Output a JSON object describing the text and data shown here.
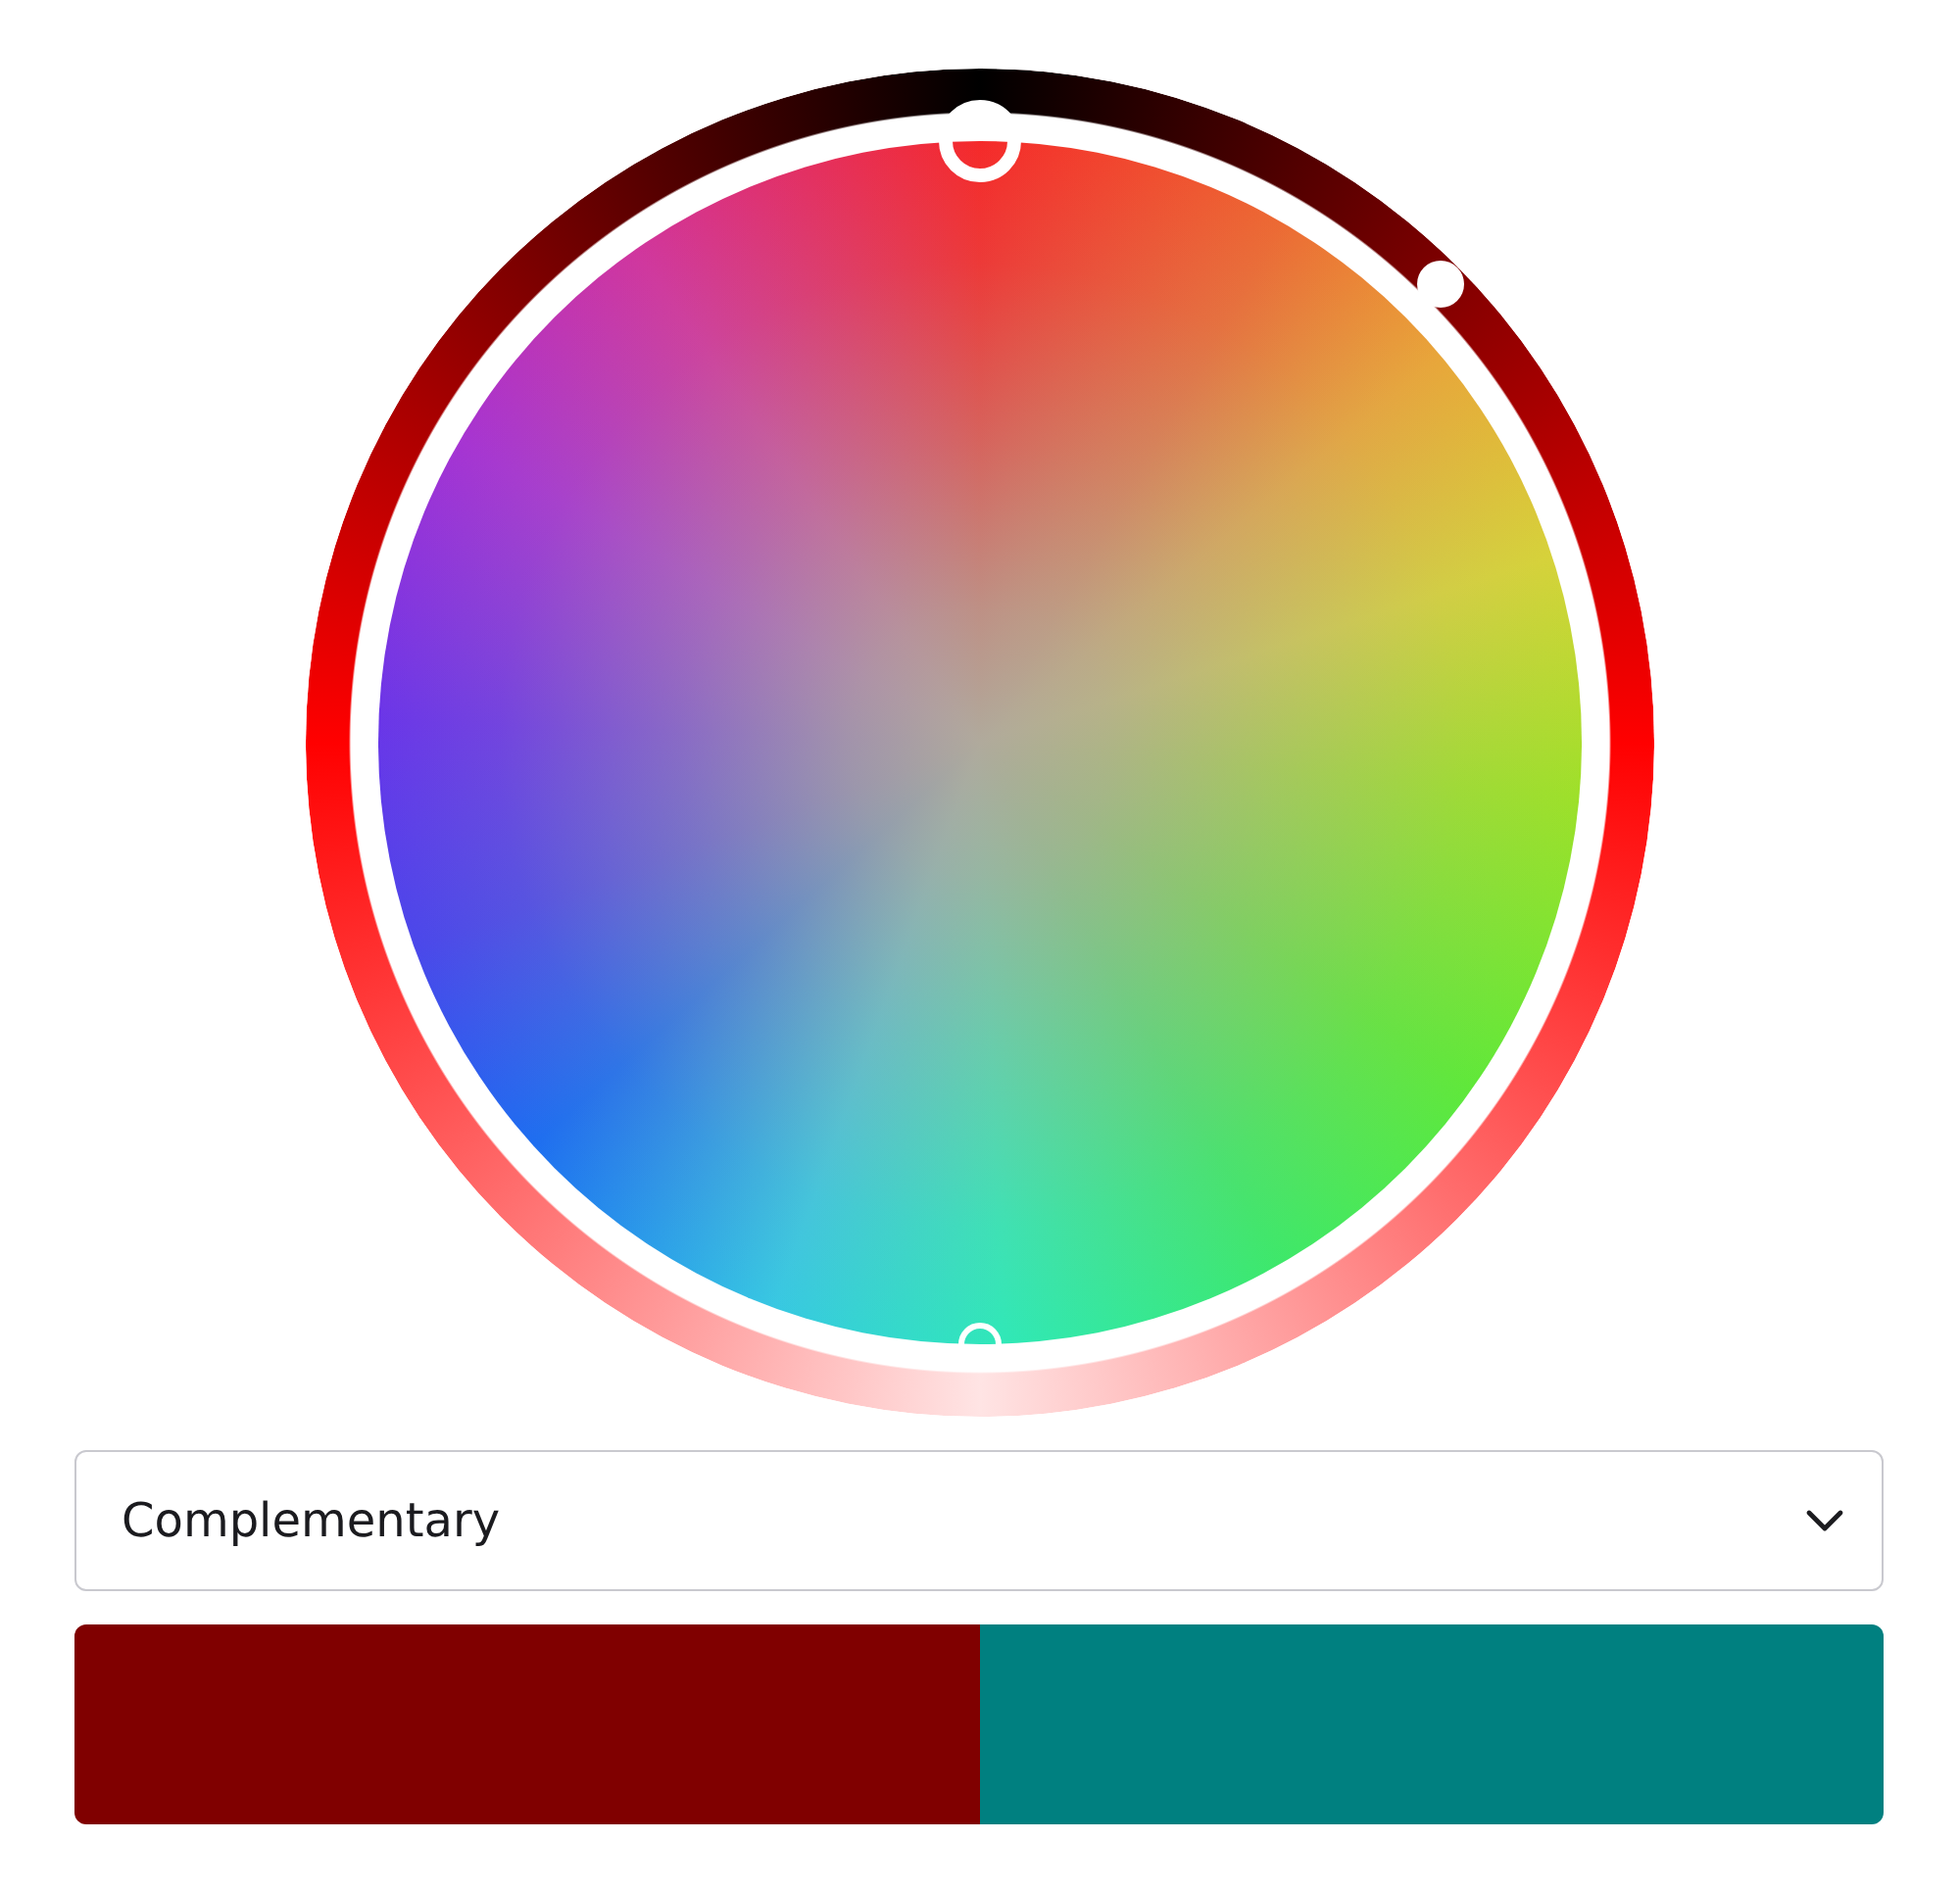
{
  "harmony_dropdown": {
    "value": "Complementary"
  },
  "palette": [
    {
      "kind": "base",
      "color": "#800000"
    },
    {
      "kind": "complement",
      "color": "#008080"
    }
  ]
}
